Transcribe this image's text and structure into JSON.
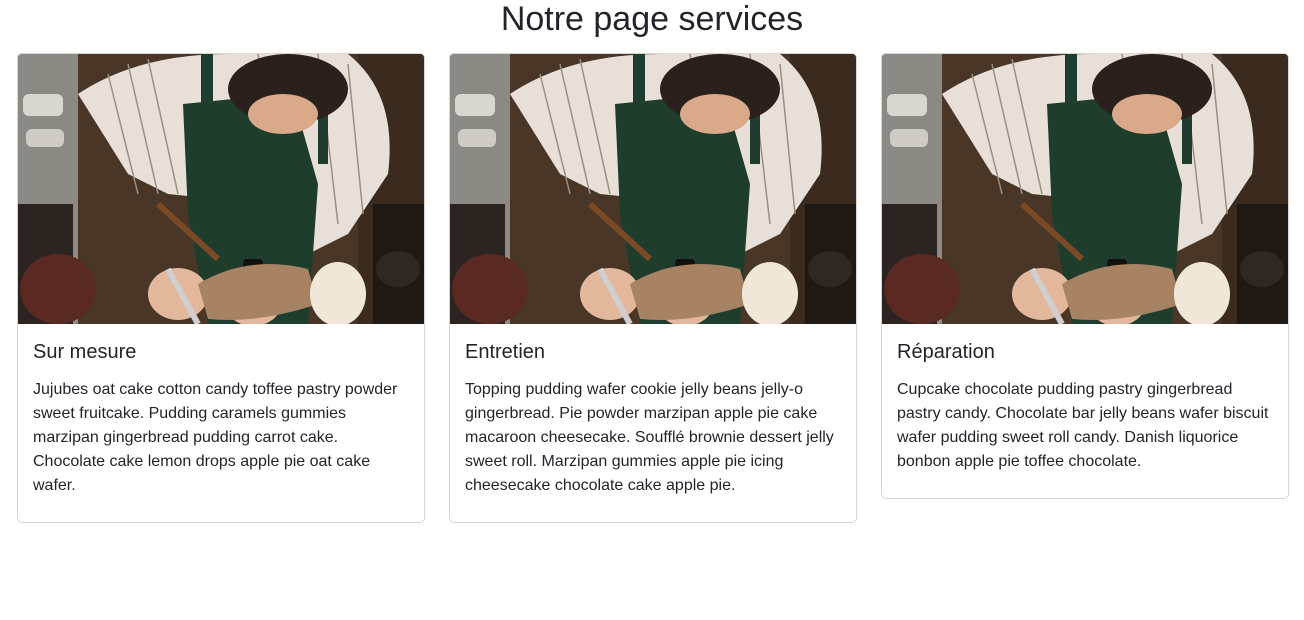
{
  "page": {
    "title": "Notre page services"
  },
  "cards": [
    {
      "image_alt": "Artisan in striped shirt and green apron working with tools",
      "title": "Sur mesure",
      "text": "Jujubes oat cake cotton candy toffee pastry powder sweet fruitcake. Pudding caramels gummies marzipan gingerbread pudding carrot cake. Chocolate cake lemon drops apple pie oat cake wafer."
    },
    {
      "image_alt": "Artisan in striped shirt and green apron working with tools",
      "title": "Entretien",
      "text": "Topping pudding wafer cookie jelly beans jelly-o gingerbread. Pie powder marzipan apple pie cake macaroon cheesecake. Soufflé brownie dessert jelly sweet roll. Marzipan gummies apple pie icing cheesecake chocolate cake apple pie."
    },
    {
      "image_alt": "Artisan in striped shirt and green apron working with tools",
      "title": "Réparation",
      "text": "Cupcake chocolate pudding pastry gingerbread pastry candy. Chocolate bar jelly beans wafer biscuit wafer pudding sweet roll candy. Danish liquorice bonbon apple pie toffee chocolate."
    }
  ],
  "colors": {
    "text": "#212529",
    "card_border": "#d5d5d5",
    "apron_green": "#1f3d2c",
    "shirt_stripe": "#e8e0d6",
    "background_shop": "#4a3626"
  }
}
